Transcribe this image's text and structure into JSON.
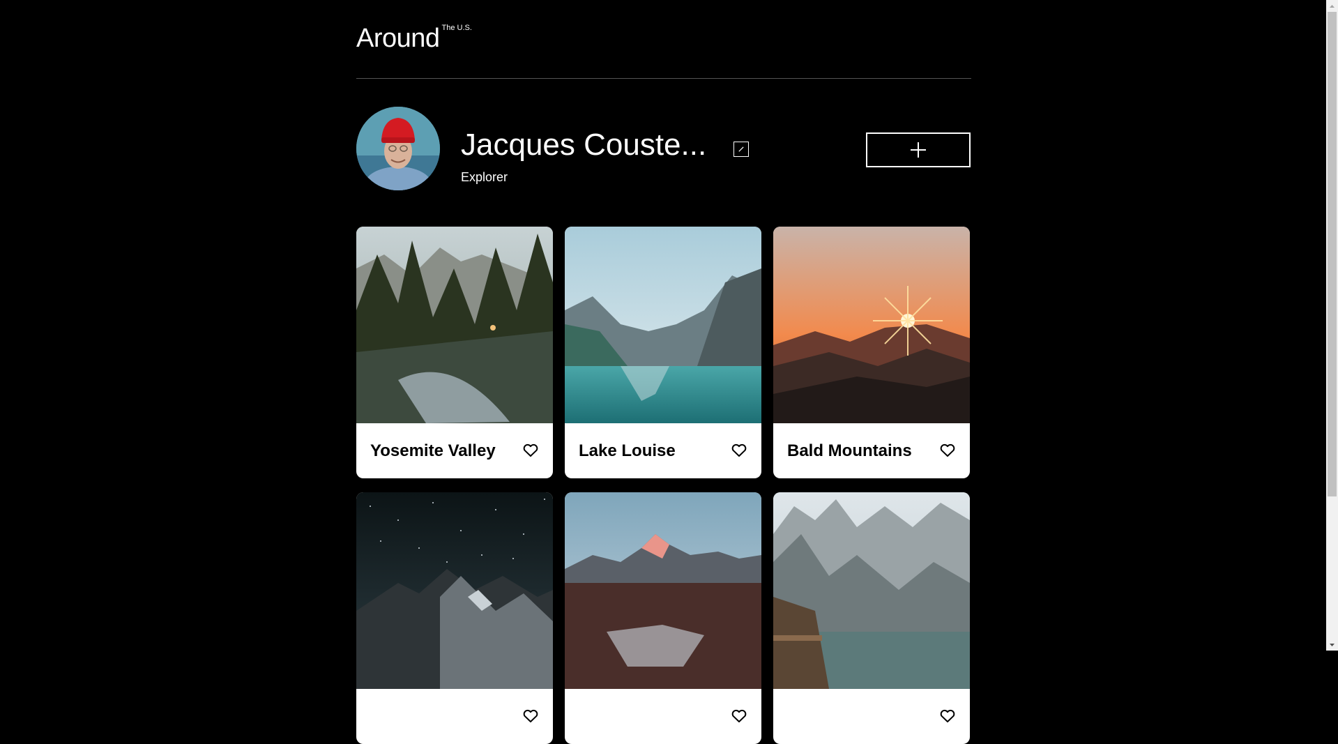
{
  "header": {
    "logo": "Around",
    "logo_sup": "The U.S."
  },
  "profile": {
    "name": "Jacques Couste...",
    "about": "Explorer"
  },
  "cards": [
    {
      "title": "Yosemite Valley"
    },
    {
      "title": "Lake Louise"
    },
    {
      "title": "Bald Mountains"
    },
    {
      "title": ""
    },
    {
      "title": ""
    },
    {
      "title": ""
    }
  ],
  "colors": {
    "background": "#000000",
    "card": "#ffffff",
    "scrollbar_track": "#f1f1f1",
    "scrollbar_thumb": "#c1c1c1"
  },
  "icons": {
    "edit": "pencil-icon",
    "add": "plus-icon",
    "like": "heart-outline-icon"
  }
}
